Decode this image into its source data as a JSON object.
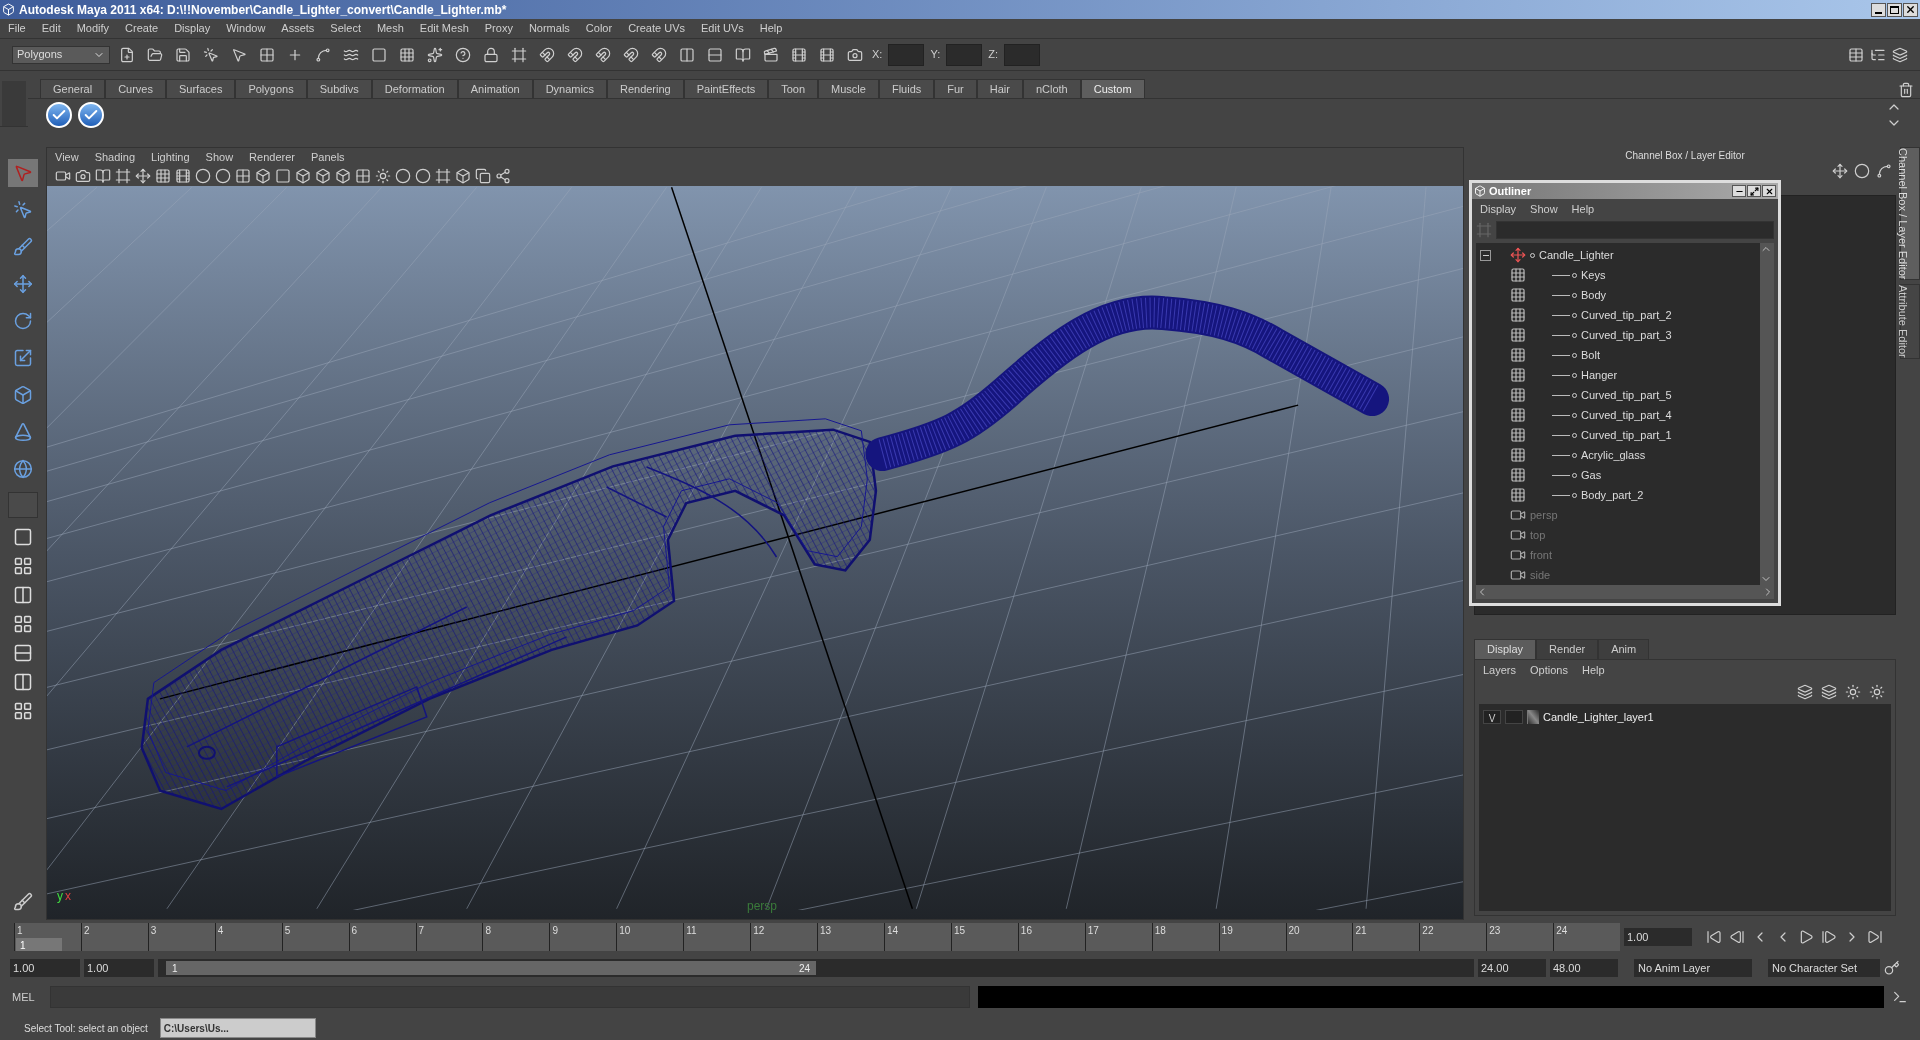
{
  "window": {
    "title": "Autodesk Maya 2011 x64: D:\\!!November\\Candle_Lighter_convert\\Candle_Lighter.mb*"
  },
  "menu_bar": [
    "File",
    "Edit",
    "Modify",
    "Create",
    "Display",
    "Window",
    "Assets",
    "Select",
    "Mesh",
    "Edit Mesh",
    "Proxy",
    "Normals",
    "Color",
    "Create UVs",
    "Edit UVs",
    "Help"
  ],
  "toolbar": {
    "mode": "Polygons",
    "coordinate_labels": [
      "X:",
      "Y:",
      "Z:"
    ]
  },
  "shelf_tabs": [
    {
      "label": "General",
      "selected": false
    },
    {
      "label": "Curves",
      "selected": false
    },
    {
      "label": "Surfaces",
      "selected": false
    },
    {
      "label": "Polygons",
      "selected": false
    },
    {
      "label": "Subdivs",
      "selected": false
    },
    {
      "label": "Deformation",
      "selected": false
    },
    {
      "label": "Animation",
      "selected": false
    },
    {
      "label": "Dynamics",
      "selected": false
    },
    {
      "label": "Rendering",
      "selected": false
    },
    {
      "label": "PaintEffects",
      "selected": false
    },
    {
      "label": "Toon",
      "selected": false
    },
    {
      "label": "Muscle",
      "selected": false
    },
    {
      "label": "Fluids",
      "selected": false
    },
    {
      "label": "Fur",
      "selected": false
    },
    {
      "label": "Hair",
      "selected": false
    },
    {
      "label": "nCloth",
      "selected": false
    },
    {
      "label": "Custom",
      "selected": true
    }
  ],
  "viewport": {
    "menu": [
      "View",
      "Shading",
      "Lighting",
      "Show",
      "Renderer",
      "Panels"
    ],
    "camera_label": "persp",
    "axis_labels": [
      "y",
      "x"
    ]
  },
  "channel_box": {
    "title": "Channel Box / Layer Editor"
  },
  "side_tabs": [
    {
      "label": "Channel Box / Layer Editor",
      "selected": true
    },
    {
      "label": "Attribute Editor",
      "selected": false
    }
  ],
  "outliner": {
    "title": "Outliner",
    "menu": [
      "Display",
      "Show",
      "Help"
    ],
    "items": [
      {
        "label": "Candle_Lighter",
        "kind": "group",
        "expanded": true,
        "children": [
          {
            "label": "Keys",
            "kind": "mesh"
          },
          {
            "label": "Body",
            "kind": "mesh"
          },
          {
            "label": "Curved_tip_part_2",
            "kind": "mesh"
          },
          {
            "label": "Curved_tip_part_3",
            "kind": "mesh"
          },
          {
            "label": "Bolt",
            "kind": "mesh"
          },
          {
            "label": "Hanger",
            "kind": "mesh"
          },
          {
            "label": "Curved_tip_part_5",
            "kind": "mesh"
          },
          {
            "label": "Curved_tip_part_4",
            "kind": "mesh"
          },
          {
            "label": "Curved_tip_part_1",
            "kind": "mesh"
          },
          {
            "label": "Acrylic_glass",
            "kind": "mesh"
          },
          {
            "label": "Gas",
            "kind": "mesh"
          },
          {
            "label": "Body_part_2",
            "kind": "mesh"
          }
        ]
      },
      {
        "label": "persp",
        "kind": "camera"
      },
      {
        "label": "top",
        "kind": "camera"
      },
      {
        "label": "front",
        "kind": "camera"
      },
      {
        "label": "side",
        "kind": "camera"
      }
    ]
  },
  "layer_editor": {
    "tabs": [
      {
        "label": "Display",
        "selected": true
      },
      {
        "label": "Render",
        "selected": false
      },
      {
        "label": "Anim",
        "selected": false
      }
    ],
    "menu": [
      "Layers",
      "Options",
      "Help"
    ],
    "layers": [
      {
        "visibility": "V",
        "name": "Candle_Lighter_layer1"
      }
    ]
  },
  "timeline": {
    "ticks": [
      {
        "label": "1",
        "selected": true
      },
      {
        "label": "2",
        "selected": false
      },
      {
        "label": "3",
        "selected": false
      },
      {
        "label": "4",
        "selected": false
      },
      {
        "label": "5",
        "selected": false
      },
      {
        "label": "6",
        "selected": false
      },
      {
        "label": "7",
        "selected": false
      },
      {
        "label": "8",
        "selected": false
      },
      {
        "label": "9",
        "selected": false
      },
      {
        "label": "10",
        "selected": false
      },
      {
        "label": "11",
        "selected": false
      },
      {
        "label": "12",
        "selected": false
      },
      {
        "label": "13",
        "selected": false
      },
      {
        "label": "14",
        "selected": false
      },
      {
        "label": "15",
        "selected": false
      },
      {
        "label": "16",
        "selected": false
      },
      {
        "label": "17",
        "selected": false
      },
      {
        "label": "18",
        "selected": false
      },
      {
        "label": "19",
        "selected": false
      },
      {
        "label": "20",
        "selected": false
      },
      {
        "label": "21",
        "selected": false
      },
      {
        "label": "22",
        "selected": false
      },
      {
        "label": "23",
        "selected": false
      },
      {
        "label": "24",
        "selected": false
      }
    ],
    "current_frame": "1",
    "current_time": "1.00"
  },
  "range_slider": {
    "start": "1.00",
    "range_start": "1.00",
    "slider_start": "1",
    "slider_end": "24",
    "range_end": "24.00",
    "end": "48.00",
    "anim_layer": "No Anim Layer",
    "character_set": "No Character Set"
  },
  "command_line": {
    "label": "MEL"
  },
  "status_bar": {
    "message": "Select Tool: select an object",
    "task_item": "C:\\Users\\Us..."
  }
}
